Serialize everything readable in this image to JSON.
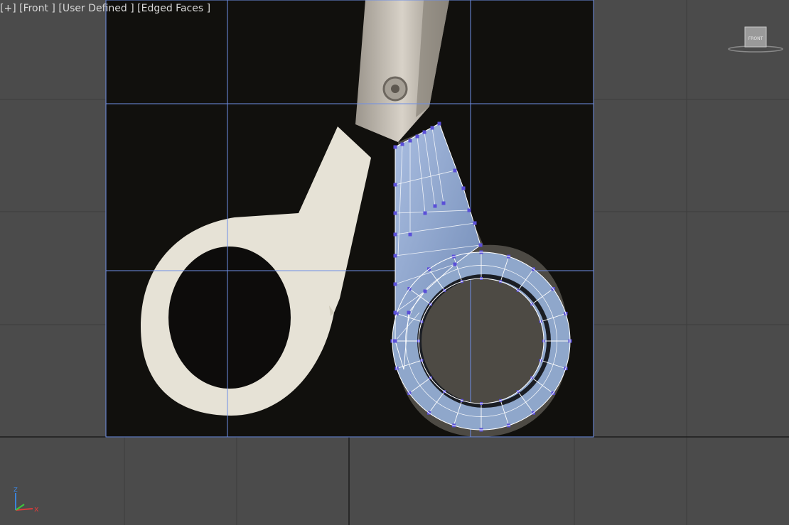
{
  "viewport": {
    "label_plus": "[+]",
    "label_view": "[Front ]",
    "label_camera": "[User Defined ]",
    "label_shading": "[Edged Faces ]",
    "viewcube_face": "FRONT",
    "axis_z": "z",
    "axis_x": "x"
  },
  "colors": {
    "background": "#4b4b4b",
    "grid": "#3a3a3a",
    "guide": "#6f8fe6",
    "mesh_face": "#8ea6c8",
    "mesh_edge": "#ffffff",
    "vertex": "#5a4fd8",
    "scissor_handle": "#e6e2d6",
    "photo_bg": "#0d0c0b"
  }
}
